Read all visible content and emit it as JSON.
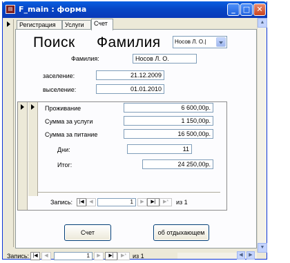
{
  "window": {
    "title": "F_main : форма",
    "minimize_glyph": "_",
    "maximize_glyph": "□",
    "close_glyph": "✕"
  },
  "tabs": [
    {
      "label": "Регистрация",
      "active": false
    },
    {
      "label": "Услуги",
      "active": false
    },
    {
      "label": "Счет",
      "active": true
    }
  ],
  "search": {
    "label_search": "Поиск",
    "label_surname": "Фамилия",
    "combo_value": "Носов Л. О.|"
  },
  "form": {
    "surname_label": "Фамилия:",
    "surname_value": "Носов Л. О.",
    "checkin_label": "заселение:",
    "checkin_value": "21.12.2009",
    "checkout_label": "выселение:",
    "checkout_value": "01.01.2010"
  },
  "subform": {
    "rows": [
      {
        "label": "Проживание",
        "value": "6 600,00р."
      },
      {
        "label": "Сумма за услуги",
        "value": "1 150,00р."
      },
      {
        "label": "Сумма за питание",
        "value": "16 500,00р."
      }
    ],
    "days_label": "Дни:",
    "days_value": "11",
    "total_label": "Итог:",
    "total_value": "24 250,00р.",
    "nav": {
      "label": "Запись:",
      "current": "1",
      "of_text": "из 1"
    }
  },
  "buttons": {
    "invoice": "Счет",
    "about_guest": "об отдыхающем"
  },
  "outer_nav": {
    "label": "Запись:",
    "current": "1",
    "of_text": "из 1"
  },
  "icons": {
    "first": "|◀",
    "prev": "◀",
    "next": "▶",
    "last": "▶|",
    "new": "▶*",
    "scroll_up": "▲",
    "scroll_down": "▼",
    "scroll_left": "◀",
    "scroll_right": "▶"
  },
  "colors": {
    "titlebar": "#0a5fe0",
    "window_bg": "#ece9d8",
    "page_bg": "#fcfcfe",
    "field_border": "#7f9db9"
  }
}
